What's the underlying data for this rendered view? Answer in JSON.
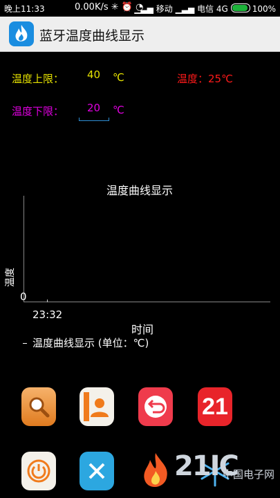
{
  "status_bar": {
    "time": "晚上11:33",
    "network_speed": "0.00K/s",
    "carrier1": "移动",
    "carrier2": "电信",
    "network_type": "4G",
    "battery": "100%"
  },
  "app": {
    "title": "蓝牙温度曲线显示"
  },
  "controls": {
    "upper_label": "温度上限：",
    "upper_value": "40",
    "upper_unit": "℃",
    "current_temp": "温度：25℃",
    "lower_label": "温度下限：",
    "lower_value": "20",
    "lower_unit": "℃"
  },
  "chart": {
    "title": "温度曲线显示",
    "y_label": "温度",
    "x_label": "时间",
    "y_tick": "0",
    "x_tick": "23:32",
    "legend": "温度曲线显示 (单位：℃)"
  },
  "chart_data": {
    "type": "line",
    "title": "温度曲线显示",
    "xlabel": "时间",
    "ylabel": "温度",
    "categories": [
      "23:32"
    ],
    "series": [
      {
        "name": "温度曲线显示 (单位：℃)",
        "values": []
      }
    ]
  },
  "dock": {
    "icons": [
      "search-app-icon",
      "contacts-app-icon",
      "back-app-icon",
      "calendar-app-icon",
      "power-app-icon",
      "tools-app-icon",
      "flame-app-icon",
      "snowflake-app-icon"
    ],
    "calendar_day": "21"
  },
  "watermark": {
    "brand": "21IC",
    "text": "中国电子网"
  }
}
